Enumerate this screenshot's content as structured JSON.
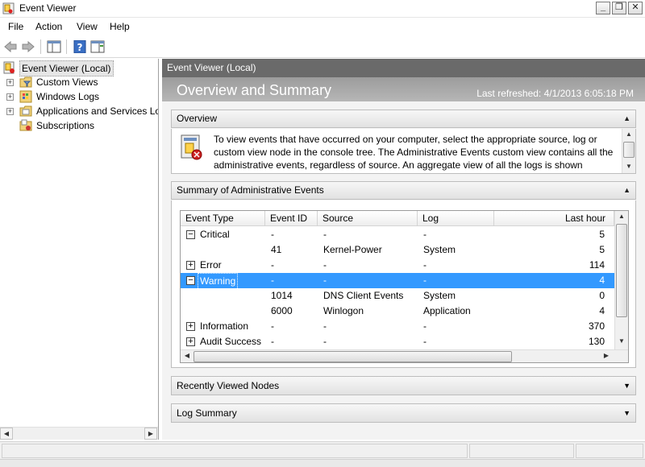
{
  "window": {
    "title": "Event Viewer"
  },
  "menu": [
    "File",
    "Action",
    "View",
    "Help"
  ],
  "tree": {
    "root": "Event Viewer (Local)",
    "items": [
      {
        "label": "Custom Views",
        "expandable": true
      },
      {
        "label": "Windows Logs",
        "expandable": true
      },
      {
        "label": "Applications and Services Lo",
        "expandable": true
      },
      {
        "label": "Subscriptions",
        "expandable": false
      }
    ]
  },
  "right": {
    "header": "Event Viewer (Local)",
    "heading": "Overview and Summary",
    "last_refreshed": "Last refreshed: 4/1/2013 6:05:18 PM"
  },
  "overview": {
    "title": "Overview",
    "text": "To view events that have occurred on your computer, select the appropriate source, log or custom view node in the console tree. The Administrative Events custom view contains all the administrative events, regardless of source. An aggregate view of all the logs is shown"
  },
  "summary": {
    "title": "Summary of Administrative Events",
    "columns": [
      "Event Type",
      "Event ID",
      "Source",
      "Log",
      "Last hour"
    ],
    "rows": [
      {
        "type": "Critical",
        "expander": "−",
        "id": "-",
        "source": "-",
        "log": "-",
        "last_hour": "5"
      },
      {
        "type": "",
        "expander": "",
        "id": "41",
        "source": "Kernel-Power",
        "log": "System",
        "last_hour": "5"
      },
      {
        "type": "Error",
        "expander": "+",
        "id": "-",
        "source": "-",
        "log": "-",
        "last_hour": "114"
      },
      {
        "type": "Warning",
        "expander": "−",
        "id": "-",
        "source": "-",
        "log": "-",
        "last_hour": "4"
      },
      {
        "type": "",
        "expander": "",
        "id": "1014",
        "source": "DNS Client Events",
        "log": "System",
        "last_hour": "0"
      },
      {
        "type": "",
        "expander": "",
        "id": "6000",
        "source": "Winlogon",
        "log": "Application",
        "last_hour": "4"
      },
      {
        "type": "Information",
        "expander": "+",
        "id": "-",
        "source": "-",
        "log": "-",
        "last_hour": "370"
      },
      {
        "type": "Audit Success",
        "expander": "+",
        "id": "-",
        "source": "-",
        "log": "-",
        "last_hour": "130"
      }
    ],
    "selected_row": 3
  },
  "collapsed_sections": [
    "Recently Viewed Nodes",
    "Log Summary"
  ]
}
